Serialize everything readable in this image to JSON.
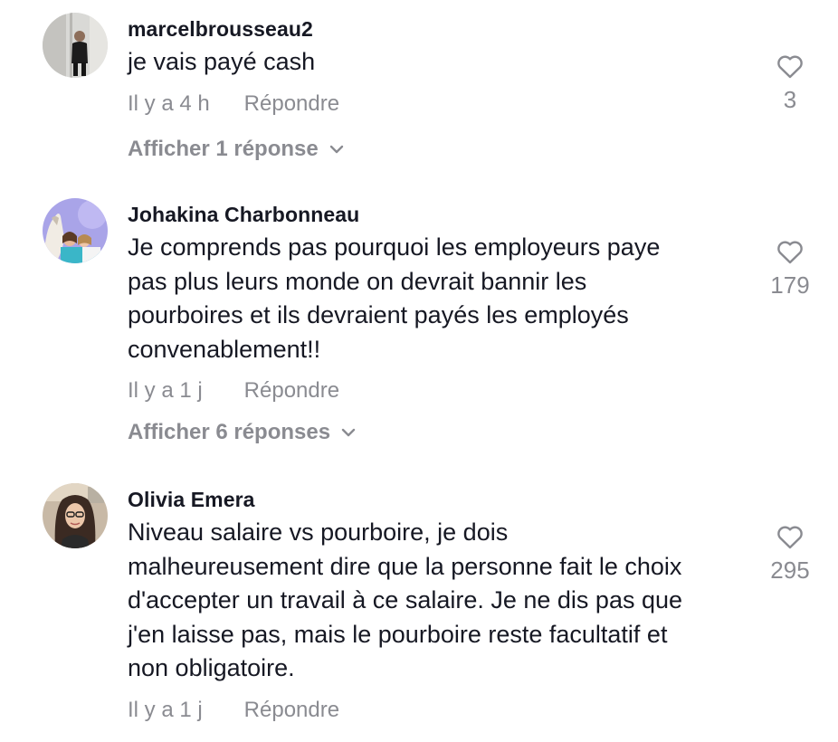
{
  "comments": [
    {
      "username": "marcelbrousseau2",
      "text": "je vais payé cash",
      "time": "Il y a 4 h",
      "reply_label": "Répondre",
      "likes": "3",
      "view_replies": "Afficher 1 réponse"
    },
    {
      "username": "Johakina Charbonneau",
      "text": "Je comprends pas pourquoi les employeurs paye\npas plus leurs monde on devrait bannir les\npourboires et ils devraient payés les employés\nconvenablement!!",
      "time": "Il y a 1 j",
      "reply_label": "Répondre",
      "likes": "179",
      "view_replies": "Afficher 6 réponses"
    },
    {
      "username": "Olivia Emera",
      "text": "Niveau salaire vs pourboire, je dois\nmalheureusement dire que la personne fait le choix\nd'accepter un travail à ce salaire. Je ne dis pas que\nj'en laisse pas, mais le pourboire reste facultatif et\nnon obligatoire.",
      "time": "Il y a 1 j",
      "reply_label": "Répondre",
      "likes": "295"
    }
  ],
  "icons": {
    "like": "heart-outline-icon",
    "expand": "chevron-down-icon"
  },
  "colors": {
    "text": "#161823",
    "secondary": "#8a8b91"
  }
}
